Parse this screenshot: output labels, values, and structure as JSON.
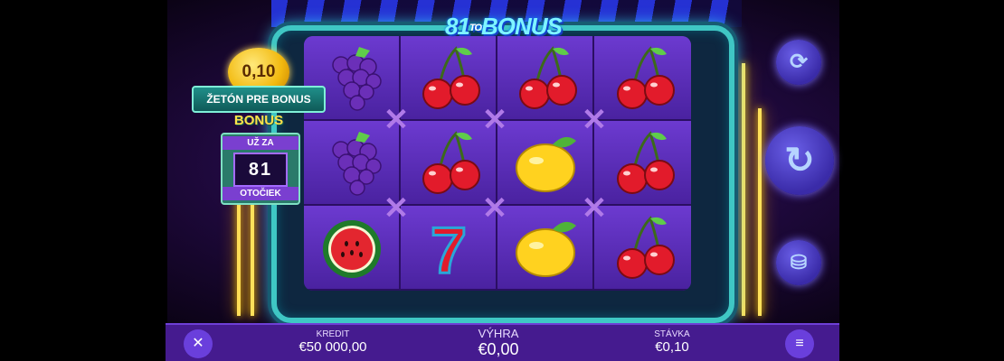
{
  "game": {
    "logo": {
      "num": "81",
      "to": "TO",
      "word": "BONUS"
    },
    "coin_value": "0,10",
    "coin_ribbon": "ŽETÓN PRE BONUS",
    "bonus": {
      "title": "BONUS",
      "top_tag": "UŽ ZA",
      "count": "81",
      "bottom_tag": "OTOČIEK"
    },
    "reels": [
      [
        "grapes",
        "cherries",
        "cherries",
        "cherries"
      ],
      [
        "grapes",
        "cherries",
        "lemon",
        "cherries"
      ],
      [
        "watermelon",
        "seven",
        "lemon",
        "cherries"
      ]
    ],
    "buttons": {
      "autoplay_icon": "autoplay-icon",
      "spin_icon": "spin-icon",
      "bet_icon": "coin-stack-icon"
    }
  },
  "bottom_bar": {
    "sound_icon": "sound-off-icon",
    "credit_label": "KREDIT",
    "credit_value": "€50 000,00",
    "win_label": "VÝHRA",
    "win_value": "€0,00",
    "bet_label": "STÁVKA",
    "bet_value": "€0,10",
    "menu_icon": "menu-icon"
  }
}
